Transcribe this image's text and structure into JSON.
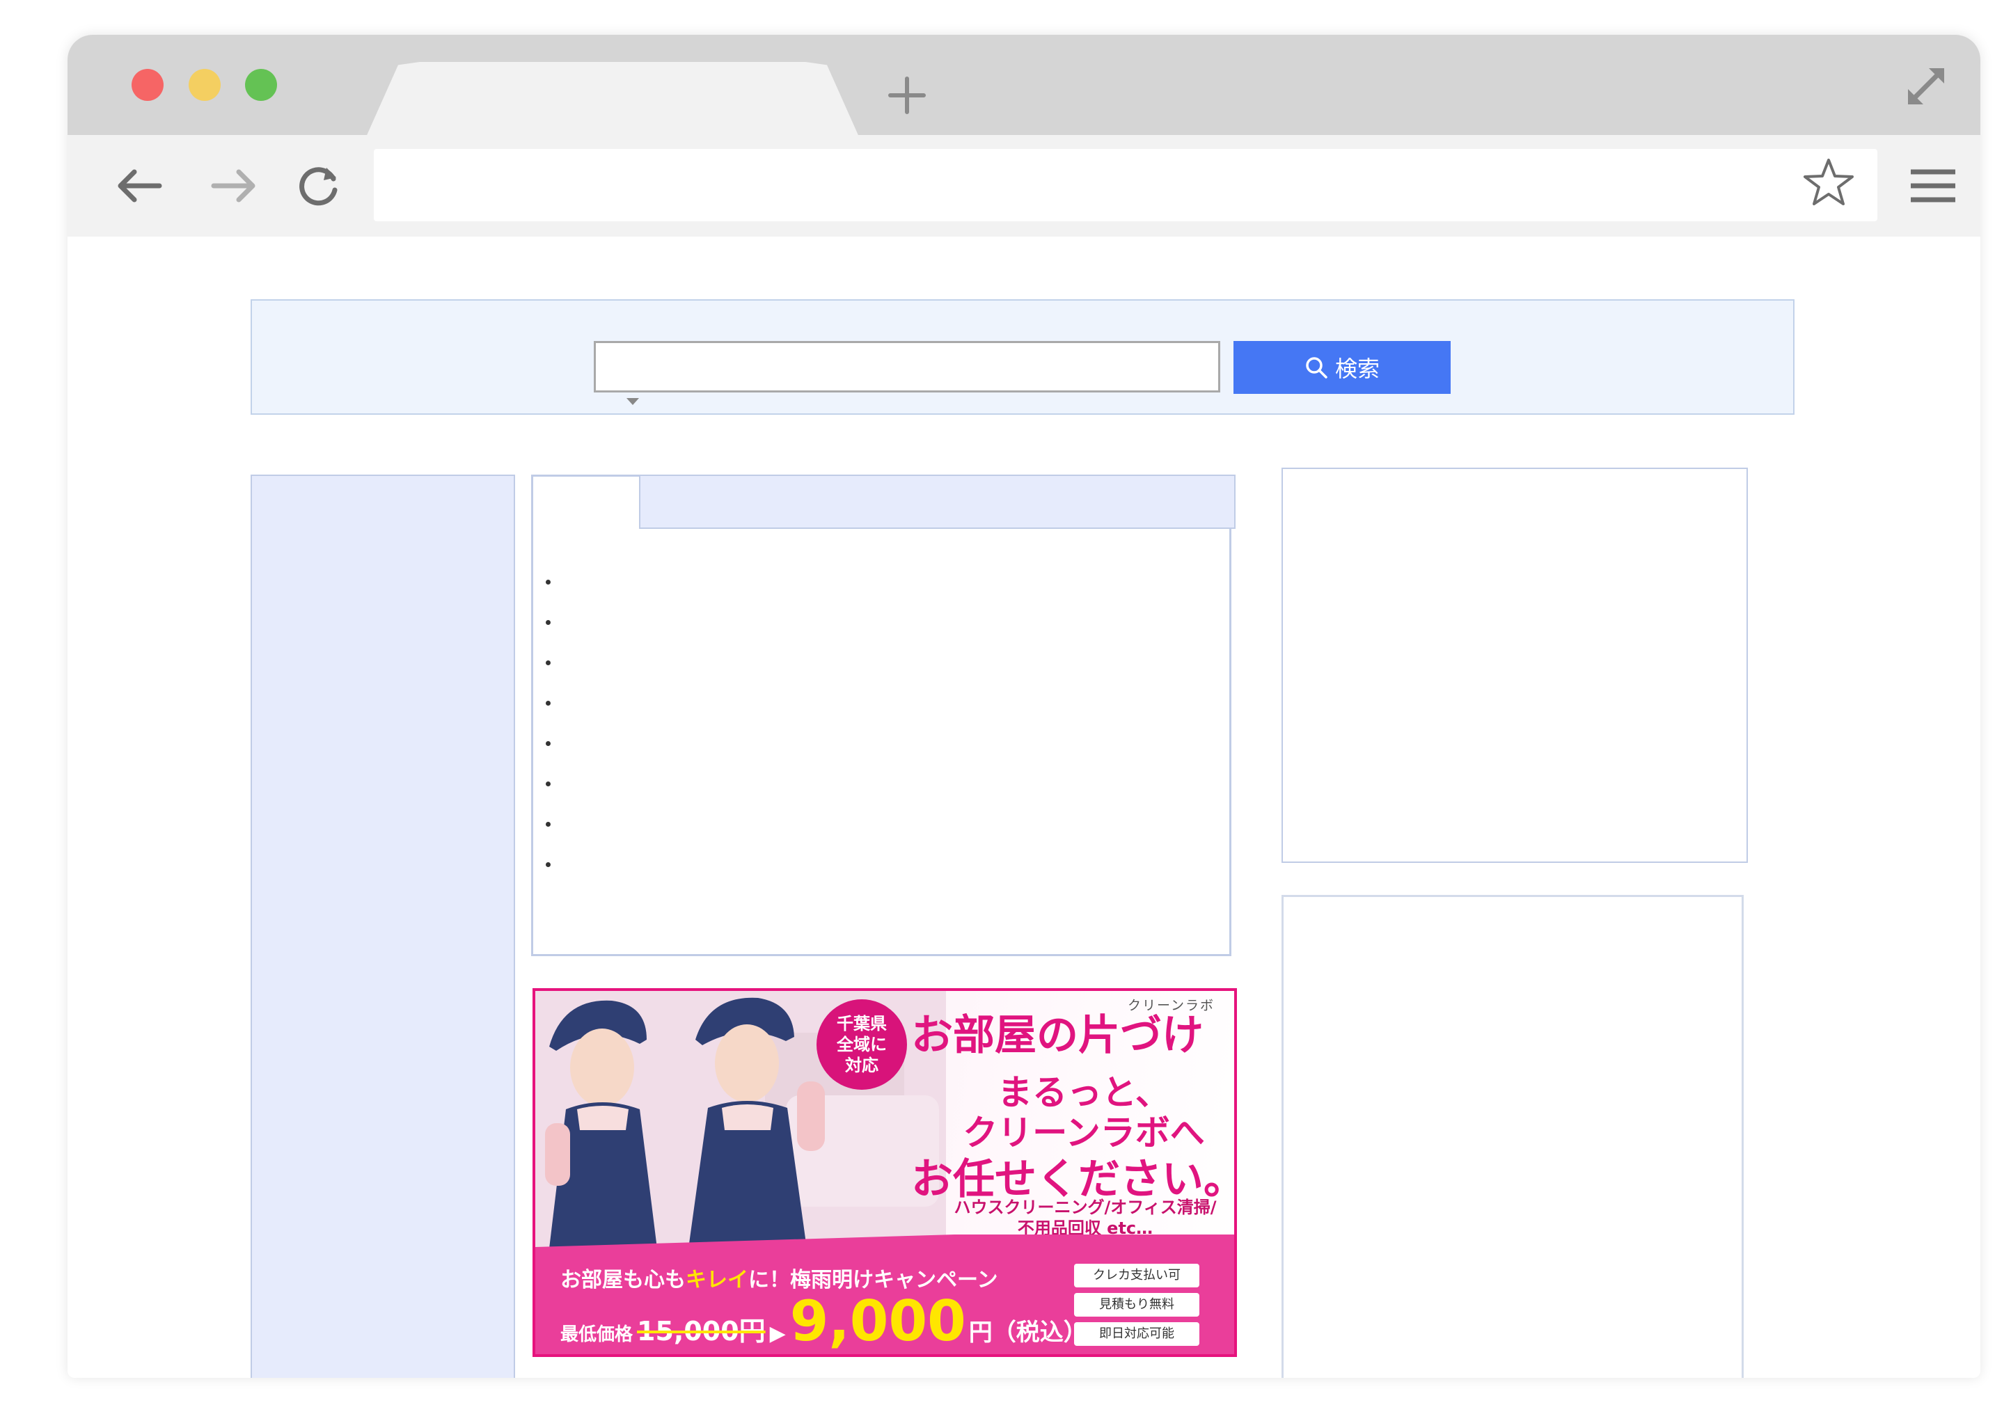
{
  "browser": {
    "address": "",
    "new_tab_icon": "plus-icon",
    "colors": {
      "close": "#f66565",
      "minimize": "#f4cf61",
      "zoom": "#64c254"
    }
  },
  "search": {
    "value": "",
    "placeholder": "",
    "button_label": "検索",
    "button_color": "#4577f4"
  },
  "news": {
    "items": [
      "",
      "",
      "",
      "",
      "",
      "",
      "",
      ""
    ]
  },
  "ad": {
    "brand": "クリーンラボ",
    "badge": [
      "千葉県",
      "全域に",
      "対応"
    ],
    "headline": "お部屋の片づけ",
    "line1": "まるっと、",
    "line2": "クリーンラボへ",
    "line3": "お任せください。",
    "services": [
      "ハウスクリーニング/オフィス清掃/",
      "不用品回収 etc…"
    ],
    "campaign_pre": "お部屋も心も",
    "campaign_hl": "キレイ",
    "campaign_post": "に！梅雨明けキャンペーン",
    "price_label": "最低価格",
    "old_price": "15,000円",
    "new_price": "9,000",
    "price_suffix": "円（税込）",
    "pills": [
      "クレカ支払い可",
      "見積もり無料",
      "即日対応可能"
    ],
    "accent": "#e0147f"
  }
}
